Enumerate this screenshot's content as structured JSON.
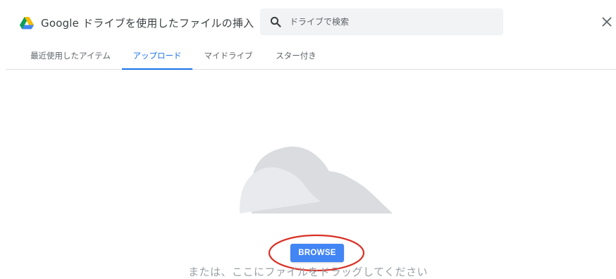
{
  "header": {
    "title": "Google ドライブを使用したファイルの挿入",
    "search_placeholder": "ドライブで検索",
    "logo_icon": "google-drive-icon",
    "search_icon": "search-icon",
    "close_icon": "close-icon"
  },
  "tabs": [
    {
      "label": "最近使用したアイテム",
      "active": false
    },
    {
      "label": "アップロード",
      "active": true
    },
    {
      "label": "マイドライブ",
      "active": false
    },
    {
      "label": "スター付き",
      "active": false
    }
  ],
  "upload": {
    "browse_label": "BROWSE",
    "drag_hint": "または、ここにファイルをドラッグしてください",
    "illustration": "cloud-illustration"
  },
  "colors": {
    "accent": "#1a73e8",
    "button": "#4285f4",
    "annotation": "#d93025",
    "cloud_back": "#dadce0",
    "cloud_front": "#e8eaed"
  }
}
